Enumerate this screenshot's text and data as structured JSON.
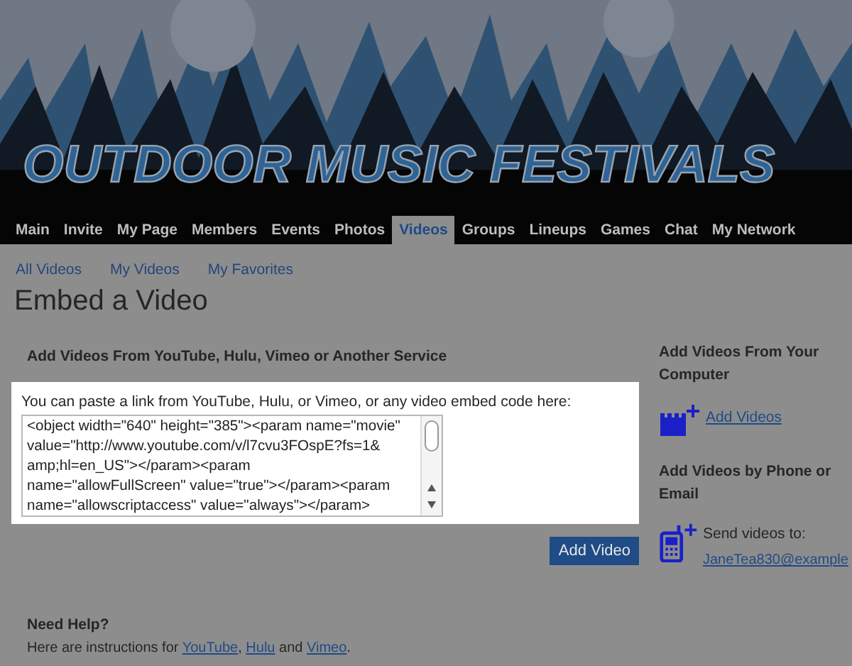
{
  "banner": {
    "title": "OUTDOOR MUSIC FESTIVALS"
  },
  "nav": [
    {
      "label": "Main",
      "selected": false
    },
    {
      "label": "Invite",
      "selected": false
    },
    {
      "label": "My Page",
      "selected": false
    },
    {
      "label": "Members",
      "selected": false
    },
    {
      "label": "Events",
      "selected": false
    },
    {
      "label": "Photos",
      "selected": false
    },
    {
      "label": "Videos",
      "selected": true
    },
    {
      "label": "Groups",
      "selected": false
    },
    {
      "label": "Lineups",
      "selected": false
    },
    {
      "label": "Games",
      "selected": false
    },
    {
      "label": "Chat",
      "selected": false
    },
    {
      "label": "My Network",
      "selected": false
    }
  ],
  "subnav": [
    "All Videos",
    "My Videos",
    "My Favorites"
  ],
  "page_title": "Embed a Video",
  "main": {
    "heading": "Add Videos From YouTube, Hulu, Vimeo or Another Service",
    "prompt": "You can paste a link from YouTube, Hulu, or Vimeo, or any video embed code here:",
    "embed_code": "<object width=\"640\" height=\"385\"><param name=\"movie\" value=\"http://www.youtube.com/v/l7cvu3FOspE?fs=1& amp;hl=en_US\"></param><param name=\"allowFullScreen\" value=\"true\"></param><param name=\"allowscriptaccess\" value=\"always\"></param>",
    "button": "Add Video"
  },
  "help": {
    "heading": "Need Help?",
    "text": "Here are instructions for ",
    "links": [
      "YouTube",
      "Hulu",
      "Vimeo"
    ],
    "joiners": [
      ", ",
      " and ",
      "."
    ]
  },
  "sidebar": [
    {
      "kind": "upload",
      "heading": "Add Videos From Your Computer",
      "link": "Add Videos"
    },
    {
      "kind": "phone",
      "heading": "Add Videos by Phone or Email",
      "text": "Send videos to:",
      "link": "JaneTea830@example"
    }
  ]
}
